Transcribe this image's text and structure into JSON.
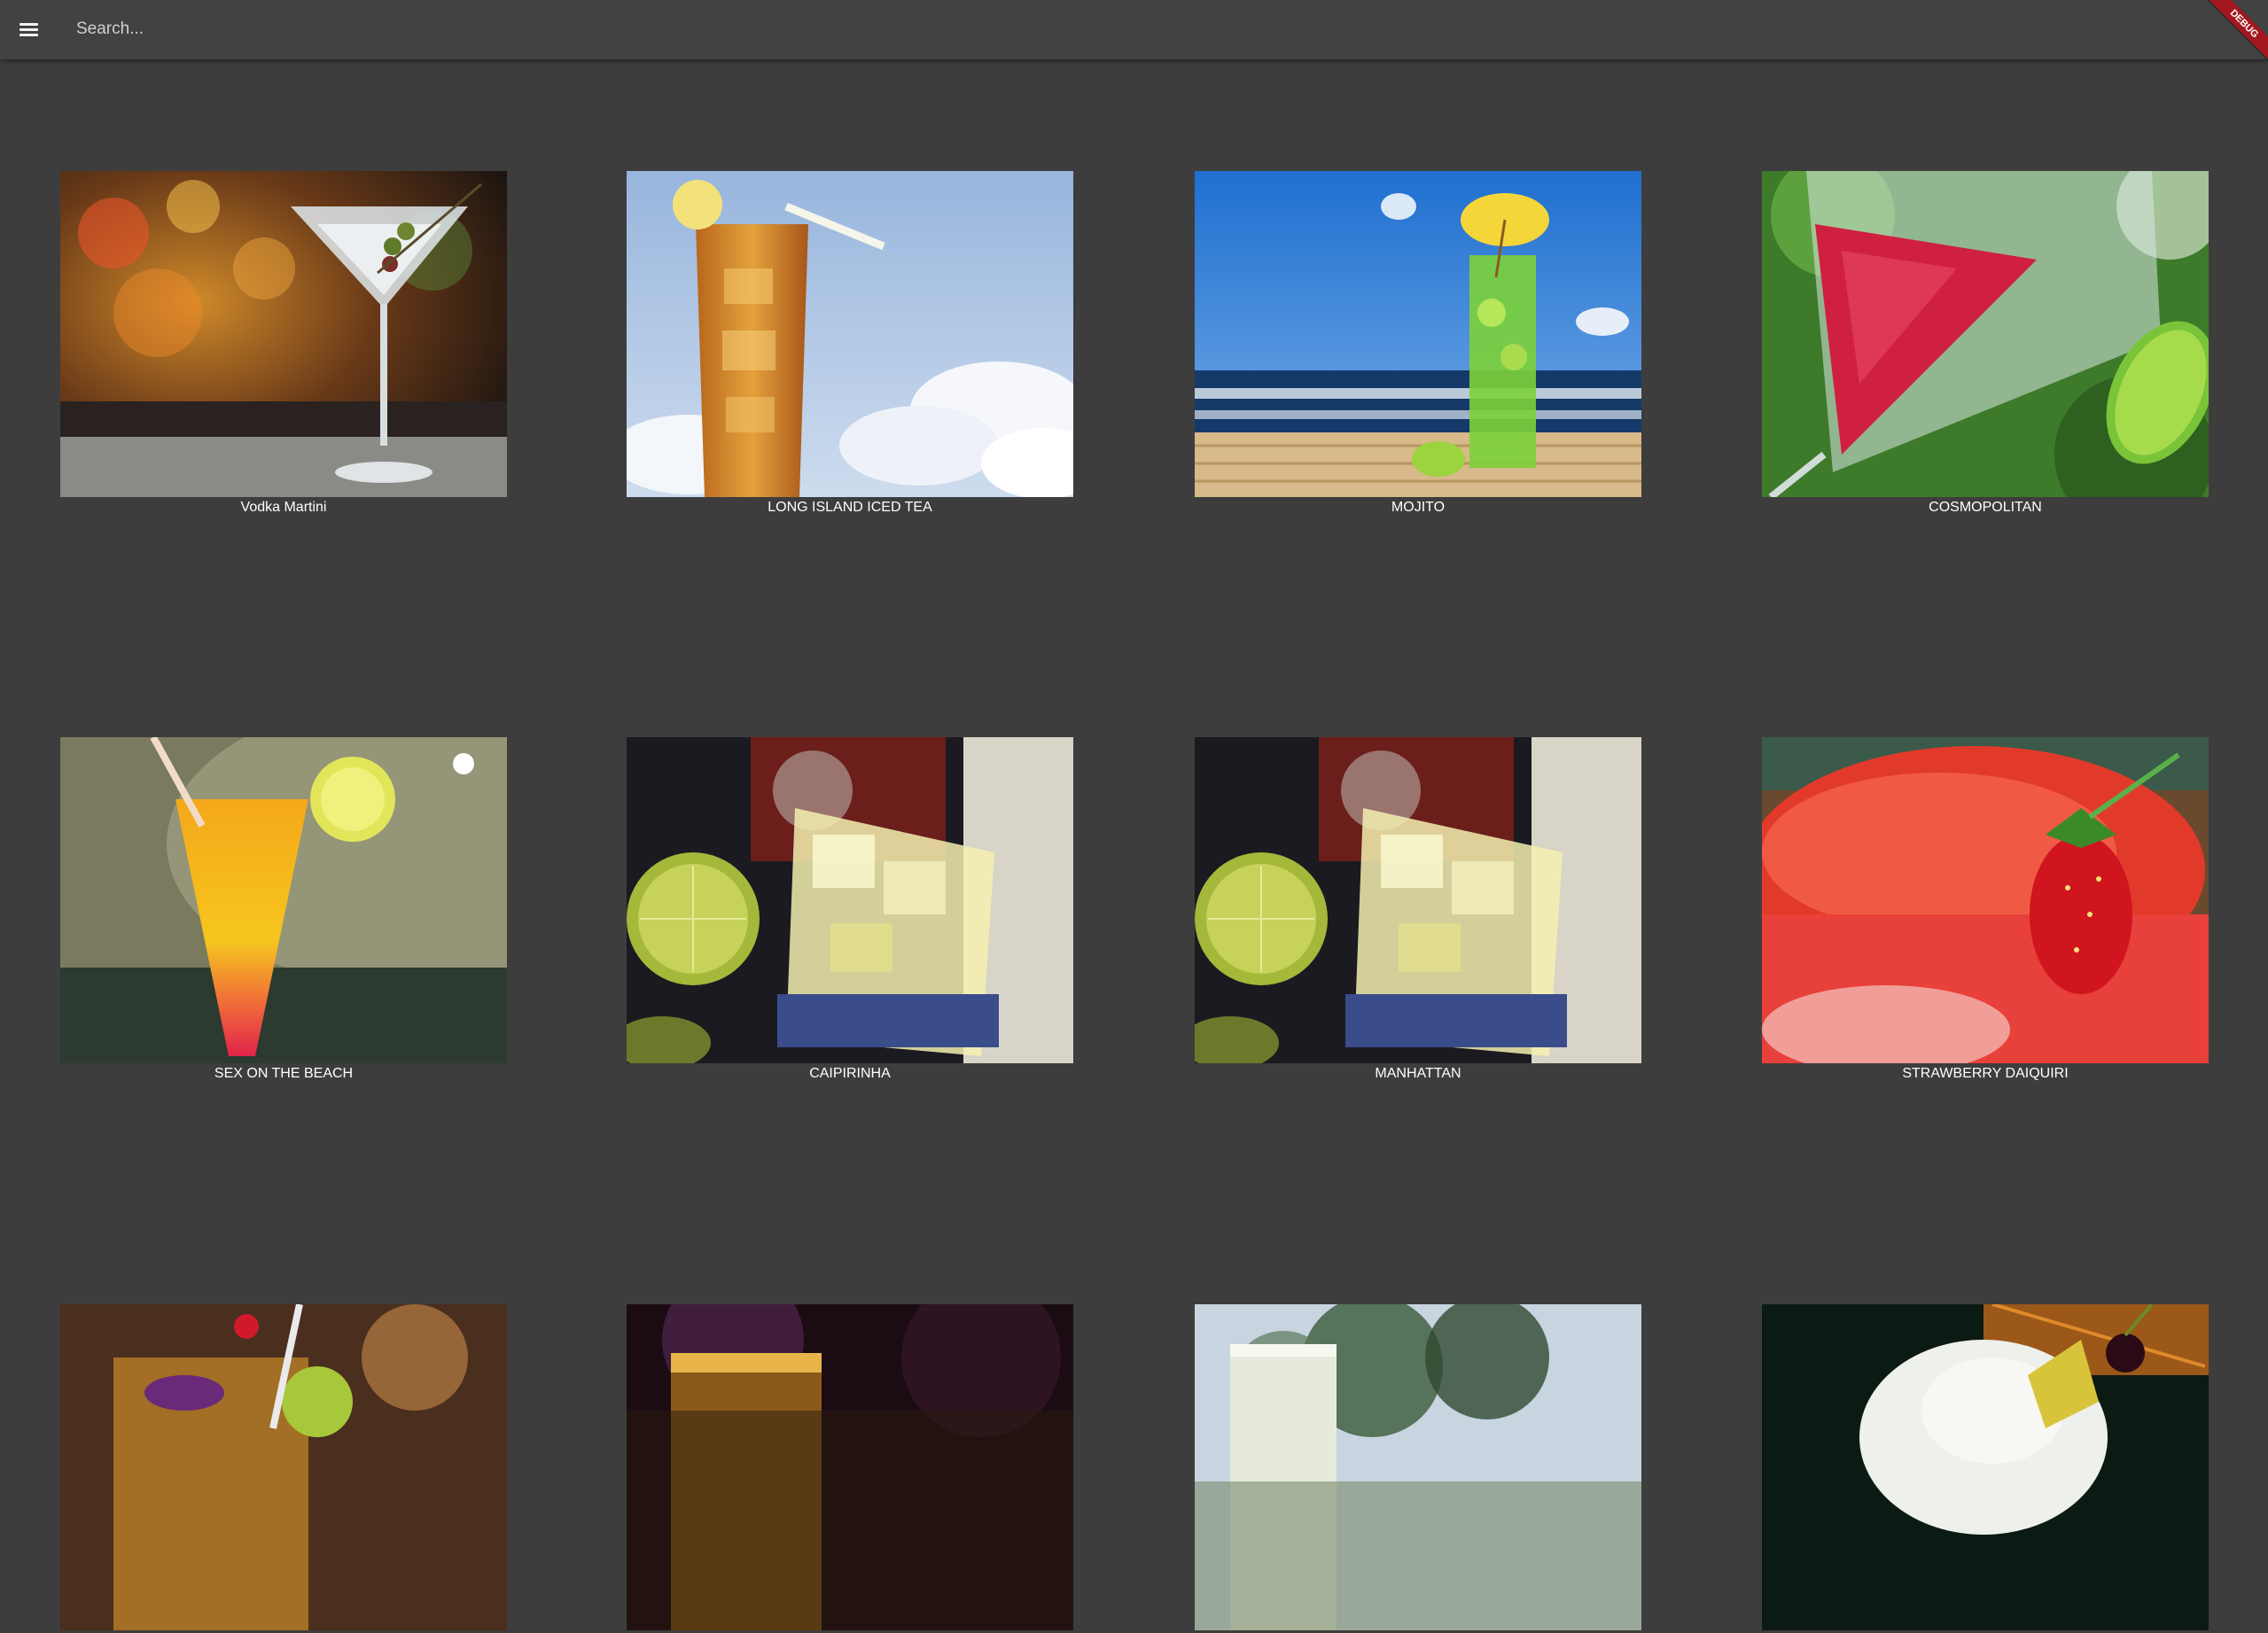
{
  "appbar": {
    "search_placeholder": "Search...",
    "debug_label": "DEBUG",
    "menu_icon": "menu-icon"
  },
  "drinks": [
    {
      "name": "Vodka Martini",
      "scene": "martini"
    },
    {
      "name": "LONG ISLAND ICED TEA",
      "scene": "icedtea"
    },
    {
      "name": "MOJITO",
      "scene": "mojito"
    },
    {
      "name": "COSMOPOLITAN",
      "scene": "cosmo"
    },
    {
      "name": "SEX ON THE BEACH",
      "scene": "sunrise"
    },
    {
      "name": "CAIPIRINHA",
      "scene": "caipirinha"
    },
    {
      "name": "MANHATTAN",
      "scene": "caipirinha"
    },
    {
      "name": "STRAWBERRY DAIQUIRI",
      "scene": "daiquiri"
    },
    {
      "name": "",
      "scene": "tiki"
    },
    {
      "name": "",
      "scene": "amber"
    },
    {
      "name": "",
      "scene": "lemonade"
    },
    {
      "name": "",
      "scene": "pina"
    }
  ],
  "colors": {
    "background": "#3d3d3d",
    "appbar": "#424242",
    "text": "#ffffff",
    "debug_banner": "#a3171e"
  }
}
